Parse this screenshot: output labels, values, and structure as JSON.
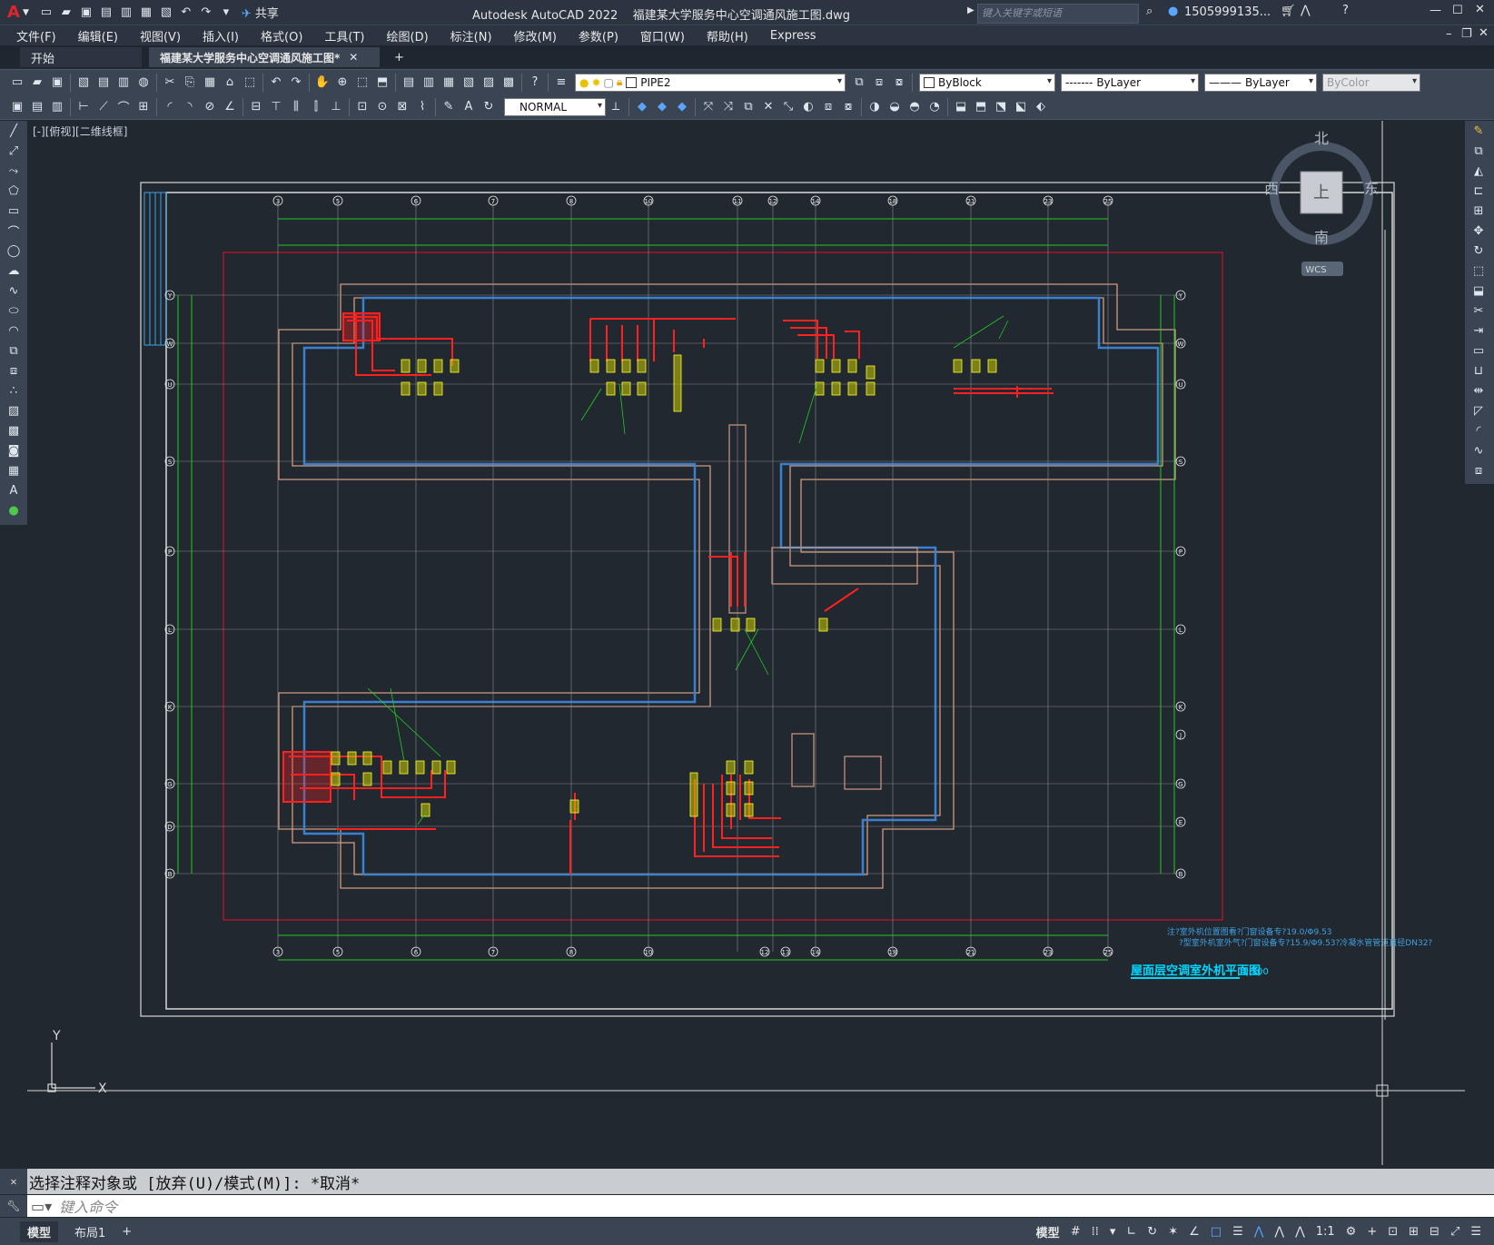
{
  "window": {
    "app_title": "Autodesk AutoCAD 2022",
    "file_name": "福建某大学服务中心空调通风施工图.dwg",
    "search_placeholder": "键入关键字或短语",
    "user": "1505999135...",
    "share_label": "共享"
  },
  "menu": [
    "文件(F)",
    "编辑(E)",
    "视图(V)",
    "插入(I)",
    "格式(O)",
    "工具(T)",
    "绘图(D)",
    "标注(N)",
    "修改(M)",
    "参数(P)",
    "窗口(W)",
    "帮助(H)",
    "Express"
  ],
  "tabs": {
    "start": "开始",
    "drawing": "福建某大学服务中心空调通风施工图*",
    "add": "+"
  },
  "properties": {
    "layer": "PIPE2",
    "color": "ByBlock",
    "linetype": "ByLayer",
    "lineweight": "ByLayer",
    "plotstyle": "ByColor",
    "text_style": "NORMAL"
  },
  "viewport": {
    "label": "[-][俯视][二维线框]"
  },
  "viewcube": {
    "north": "北",
    "south": "南",
    "east": "东",
    "west": "西",
    "top": "上",
    "wcs": "WCS"
  },
  "ucs": {
    "x": "X",
    "y": "Y"
  },
  "drawing": {
    "title": "屋面层空调室外机平面图",
    "scale": "1:100",
    "note1": "注?室外机位置图看?门窗设备专?19.0/Φ9.53",
    "note2": "?型室外机室外气?门窗设备专?15.9/Φ9.53?冷凝水管管道直径DN32?",
    "top_axes": [
      "3",
      "5",
      "6",
      "7",
      "8",
      "10",
      "11",
      "12",
      "14",
      "18",
      "21",
      "23",
      "25"
    ],
    "bottom_axes": [
      "3",
      "5",
      "6",
      "7",
      "8",
      "10",
      "12",
      "13",
      "14",
      "18",
      "21",
      "23",
      "25"
    ],
    "left_axes": [
      "Y",
      "W",
      "U",
      "S",
      "P",
      "L",
      "K",
      "G",
      "D",
      "B"
    ],
    "right_axes": [
      "Y",
      "W",
      "U",
      "S",
      "P",
      "L",
      "K",
      "J",
      "G",
      "E",
      "B"
    ]
  },
  "command": {
    "history": "选择注释对象或 [放弃(U)/模式(M)]: *取消*",
    "placeholder": "键入命令"
  },
  "layout_tabs": [
    "模型",
    "布局1",
    "+"
  ],
  "status": {
    "model": "模型",
    "scale": "1:1"
  }
}
